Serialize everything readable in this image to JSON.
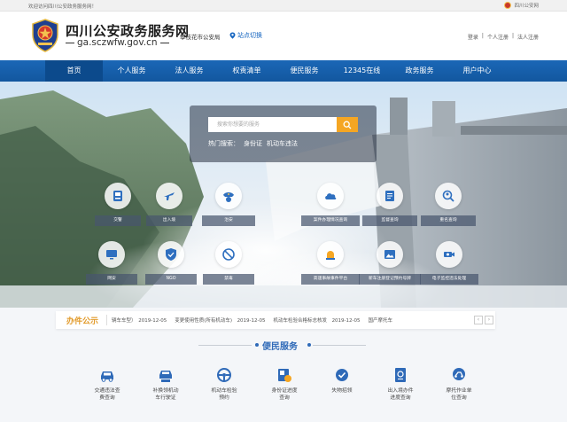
{
  "topbar": {
    "welcome": "欢迎访问四川公安政务服务网！",
    "account_label": "四川公安网"
  },
  "brand": {
    "title": "四川公安政务服务网",
    "url": "ga.sczwfw.gov.cn",
    "region": "攀枝花市公安局",
    "station_switch": "站点切换"
  },
  "header_links": {
    "login": "登录",
    "personal_register": "个人注册",
    "corp_register": "法人注册",
    "separator": "|"
  },
  "nav": {
    "items": [
      {
        "label": "首页"
      },
      {
        "label": "个人服务"
      },
      {
        "label": "法人服务"
      },
      {
        "label": "权责清单"
      },
      {
        "label": "便民服务"
      },
      {
        "label": "12345在线"
      },
      {
        "label": "政务服务"
      },
      {
        "label": "用户中心"
      }
    ],
    "active_index": 0
  },
  "search": {
    "placeholder": "搜索你想要的服务",
    "hot_label": "热门搜索：",
    "hot_terms": [
      "身份证",
      "机动车违法"
    ]
  },
  "services_left": [
    {
      "label": "交警",
      "icon": "id-card-icon"
    },
    {
      "label": "出入境",
      "icon": "plane-icon"
    },
    {
      "label": "治安",
      "icon": "police-cap-icon"
    },
    {
      "label": "网安",
      "icon": "monitor-icon"
    },
    {
      "label": "NGO",
      "icon": "shield-icon"
    },
    {
      "label": "禁毒",
      "icon": "no-drugs-icon"
    }
  ],
  "services_right": [
    {
      "label": "案件办理情况查询",
      "icon": "cloud-icon"
    },
    {
      "label": "监督查询",
      "icon": "document-icon"
    },
    {
      "label": "重名查询",
      "icon": "search-person-icon"
    },
    {
      "label": "高速事故事件平台",
      "icon": "alarm-light-icon"
    },
    {
      "label": "新车注册登记预约号牌",
      "icon": "picture-icon"
    },
    {
      "label": "电子监控违法处理",
      "icon": "camera-icon"
    }
  ],
  "notice": {
    "title": "办件公示",
    "items": [
      {
        "text": "辆车车型）",
        "date": "2019-12-05"
      },
      {
        "text": "变更使用性质(所有机动车)",
        "date": "2019-12-05"
      },
      {
        "text": "机动车检验合格标志核发",
        "date": "2019-12-05"
      },
      {
        "text": "国产摩托车",
        "date": ""
      }
    ],
    "prev": "‹",
    "next": "›"
  },
  "bianmin": {
    "title": "便民服务",
    "items": [
      {
        "label": "交通违法查\n费查询",
        "icon": "car-violation-icon"
      },
      {
        "label": "补换领机动\n车行驶证",
        "icon": "car-license-icon"
      },
      {
        "label": "机动车检验\n预约",
        "icon": "steering-wheel-icon"
      },
      {
        "label": "身份证进度\n查询",
        "icon": "id-progress-icon"
      },
      {
        "label": "失物招领",
        "icon": "lost-found-icon"
      },
      {
        "label": "出入境办件\n进度查询",
        "icon": "passport-icon"
      },
      {
        "label": "摩托作业单\n位查询",
        "icon": "motorbike-icon"
      }
    ]
  },
  "colors": {
    "nav_blue": "#1b67b6",
    "nav_active": "#0c4a8c",
    "search_button": "#f5a623",
    "notice_title": "#e29b2b",
    "section_blue": "#2f6ab8"
  }
}
